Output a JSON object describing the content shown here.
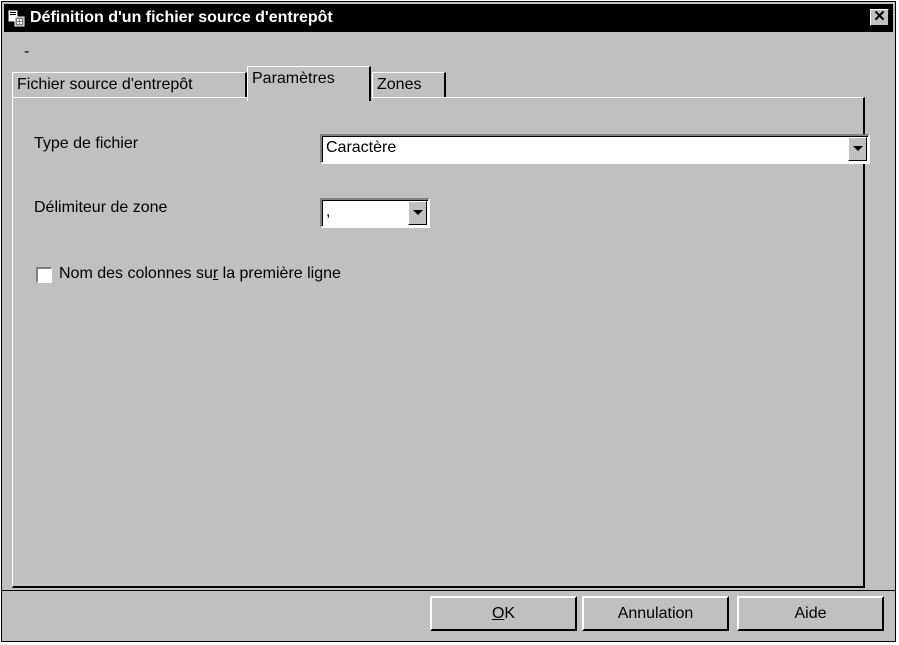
{
  "window": {
    "title": "Définition d'un fichier source d'entrepôt",
    "close_label": "✕",
    "menu_text": "-"
  },
  "tabs": [
    {
      "label": "Fichier source d'entrepôt",
      "active": false
    },
    {
      "label": "Paramètres",
      "active": true
    },
    {
      "label": "Zones",
      "active": false
    }
  ],
  "params": {
    "file_type_label": "Type de fichier",
    "file_type_value": "Caractère",
    "delimiter_label": "Délimiteur de zone",
    "delimiter_value": ",",
    "header_checkbox": {
      "label_before": "Nom des colonnes su",
      "label_mnemonic": "r",
      "label_after": " la première ligne",
      "checked": false
    }
  },
  "buttons": {
    "ok_mnemonic": "O",
    "ok_rest": "K",
    "cancel": "Annulation",
    "help": "Aide"
  },
  "colors": {
    "face": "#c0c0c0",
    "titlebar": "#000000"
  }
}
